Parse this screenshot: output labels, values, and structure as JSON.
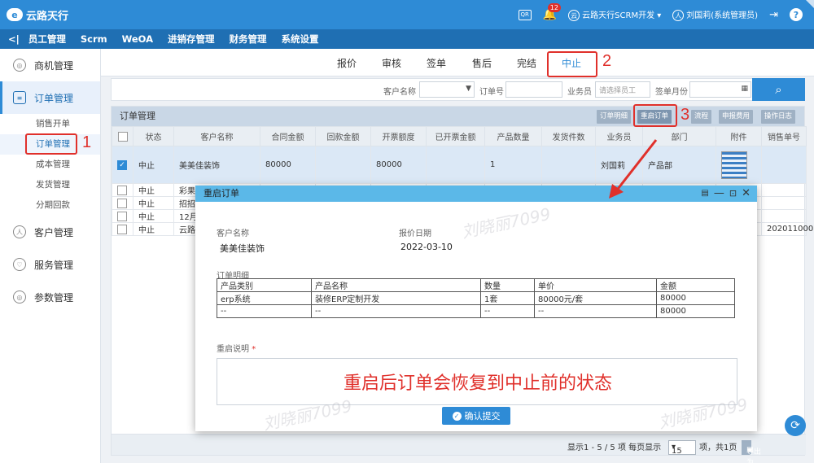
{
  "header": {
    "app_name": "云路天行",
    "logo_mark": "e",
    "qr_label": "QR",
    "notification_count": "12",
    "company": "云路天行SCRM开发 ▾",
    "user": "刘国莉(系统管理员)",
    "help": "?"
  },
  "nav": {
    "back": "<|",
    "items": [
      "员工管理",
      "Scrm",
      "WeOA",
      "进销存管理",
      "财务管理",
      "系统设置"
    ]
  },
  "sidebar": {
    "items": [
      {
        "label": "商机管理"
      },
      {
        "label": "订单管理"
      },
      {
        "label": "客户管理"
      },
      {
        "label": "服务管理"
      },
      {
        "label": "参数管理"
      }
    ],
    "sub_items": [
      "销售开单",
      "订单管理",
      "成本管理",
      "发货管理",
      "分期回款"
    ]
  },
  "stage_tabs": [
    "报价",
    "审核",
    "签单",
    "售后",
    "完结",
    "中止"
  ],
  "filter": {
    "customer_label": "客户名称",
    "order_label": "订单号",
    "staff_label": "业务员",
    "staff_placeholder": "请选择员工",
    "month_label": "签单月份",
    "search_icon": "🔍"
  },
  "grid": {
    "title": "订单管理",
    "buttons": [
      "订单明细",
      "重启订单",
      "流程",
      "申报费用",
      "操作日志"
    ],
    "columns": [
      "状态",
      "客户名称",
      "合同金额",
      "回款金额",
      "开票额度",
      "已开票金额",
      "产品数量",
      "发货件数",
      "业务员",
      "部门",
      "附件",
      "销售单号"
    ],
    "rows": [
      {
        "status": "中止",
        "customer": "美美佳装饰",
        "contract": "80000",
        "paid": "",
        "invoice_limit": "80000",
        "invoiced": "",
        "qty": "1",
        "shipped": "",
        "staff": "刘国莉",
        "dept": "产品部",
        "sales_no": ""
      },
      {
        "status": "中止",
        "customer": "彩果",
        "contract": "",
        "paid": "",
        "invoice_limit": "",
        "invoiced": "",
        "qty": "",
        "shipped": "",
        "staff": "",
        "dept": "",
        "sales_no": ""
      },
      {
        "status": "中止",
        "customer": "招招",
        "contract": "",
        "paid": "",
        "invoice_limit": "",
        "invoiced": "",
        "qty": "",
        "shipped": "",
        "staff": "",
        "dept": "",
        "sales_no": ""
      },
      {
        "status": "中止",
        "customer": "12月",
        "contract": "",
        "paid": "",
        "invoice_limit": "",
        "invoiced": "",
        "qty": "",
        "shipped": "",
        "staff": "",
        "dept": "",
        "sales_no": ""
      },
      {
        "status": "中止",
        "customer": "云路",
        "contract": "",
        "paid": "",
        "invoice_limit": "",
        "invoiced": "",
        "qty": "",
        "shipped": "",
        "staff": "",
        "dept": "",
        "sales_no": "2020110001"
      }
    ],
    "pager": {
      "summary": "显示1 - 5 / 5 项 每页显示",
      "page_size": "15",
      "total": "项，共1页",
      "export": "导出为excel"
    }
  },
  "dialog": {
    "title": "重启订单",
    "customer_label": "客户名称",
    "customer_value": "美美佳装饰",
    "date_label": "报价日期",
    "date_value": "2022-03-10",
    "detail_label": "订单明细",
    "item_headers": [
      "产品类别",
      "产品名称",
      "数量",
      "单价",
      "金额"
    ],
    "item_rows": [
      [
        "erp系统",
        "装修ERP定制开发",
        "1套",
        "80000元/套",
        "80000"
      ],
      [
        "--",
        "--",
        "--",
        "--",
        "80000"
      ]
    ],
    "reason_label": "重启说明",
    "required_mark": "*",
    "reason_text": "重启后订单会恢复到中止前的状态",
    "submit_label": "确认提交"
  },
  "annotations": [
    "1",
    "2",
    "3"
  ],
  "watermark": "刘晓丽7099"
}
